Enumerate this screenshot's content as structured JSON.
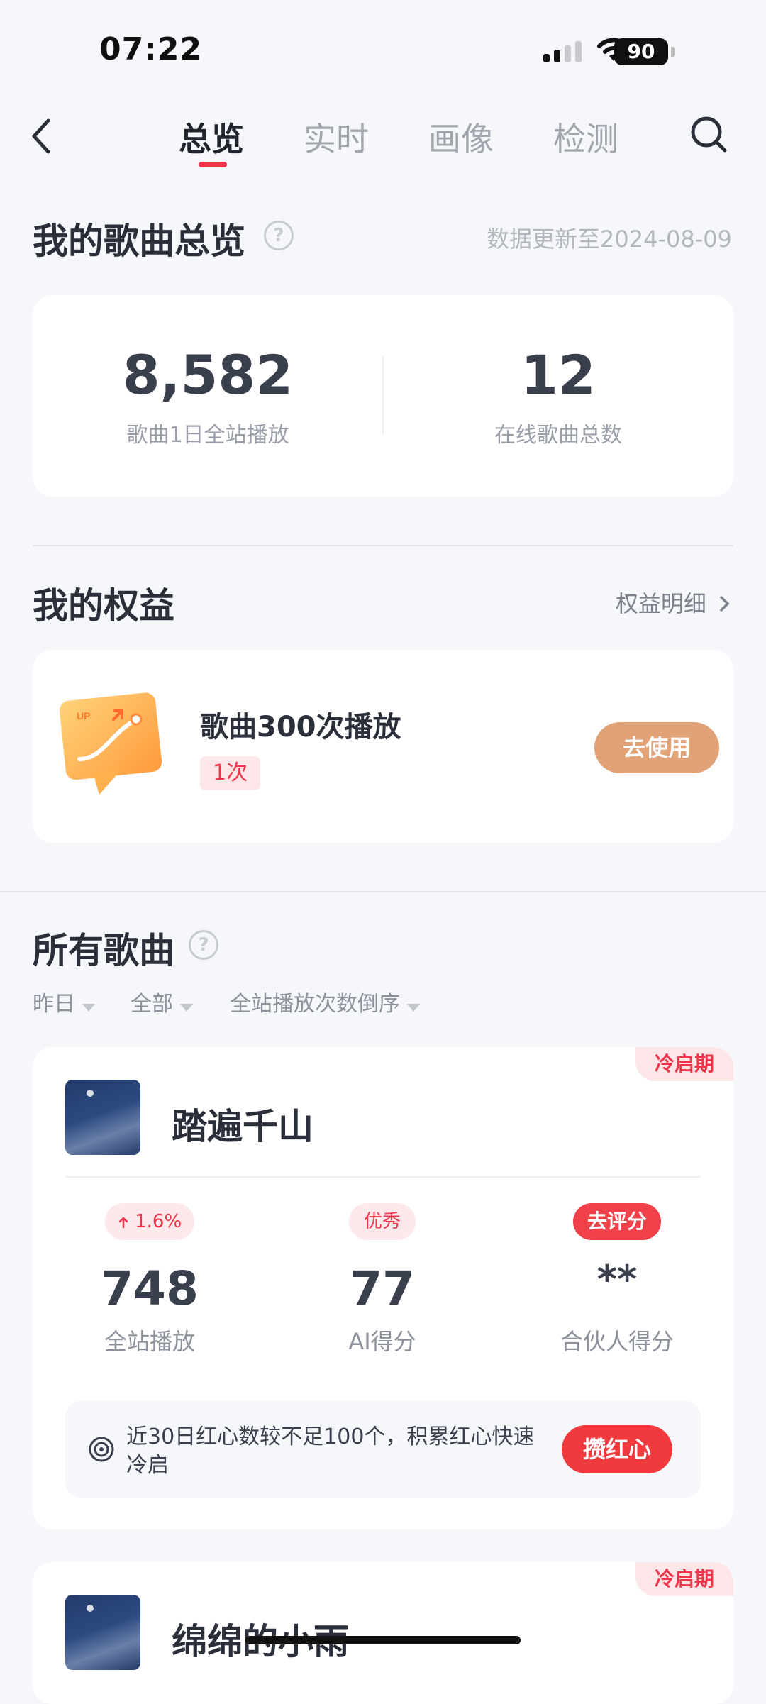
{
  "status": {
    "time": "07:22",
    "battery": "90"
  },
  "nav": {
    "tabs": [
      "总览",
      "实时",
      "画像",
      "检测"
    ],
    "active": 0
  },
  "overview": {
    "title": "我的歌曲总览",
    "updated": "数据更新至2024-08-09",
    "stats": [
      {
        "value": "8,582",
        "label": "歌曲1日全站播放"
      },
      {
        "value": "12",
        "label": "在线歌曲总数"
      }
    ]
  },
  "rights": {
    "title": "我的权益",
    "detail_link": "权益明细",
    "item": {
      "name": "歌曲300次播放",
      "badge": "1次",
      "action": "去使用",
      "icon_text": "UP"
    }
  },
  "songs": {
    "title": "所有歌曲",
    "filters": [
      "昨日",
      "全部",
      "全站播放次数倒序"
    ],
    "list": [
      {
        "title": "踏遍千山",
        "tag": "冷启期",
        "metrics": [
          {
            "badge": "1.6%",
            "value": "748",
            "label": "全站播放"
          },
          {
            "badge": "优秀",
            "value": "77",
            "label": "AI得分"
          },
          {
            "badge": "去评分",
            "value": "**",
            "label": "合伙人得分"
          }
        ],
        "tip": "近30日红心数较不足100个，积累红心快速冷启",
        "tip_action": "攒红心"
      },
      {
        "title": "绵绵的小雨",
        "tag": "冷启期"
      }
    ]
  }
}
